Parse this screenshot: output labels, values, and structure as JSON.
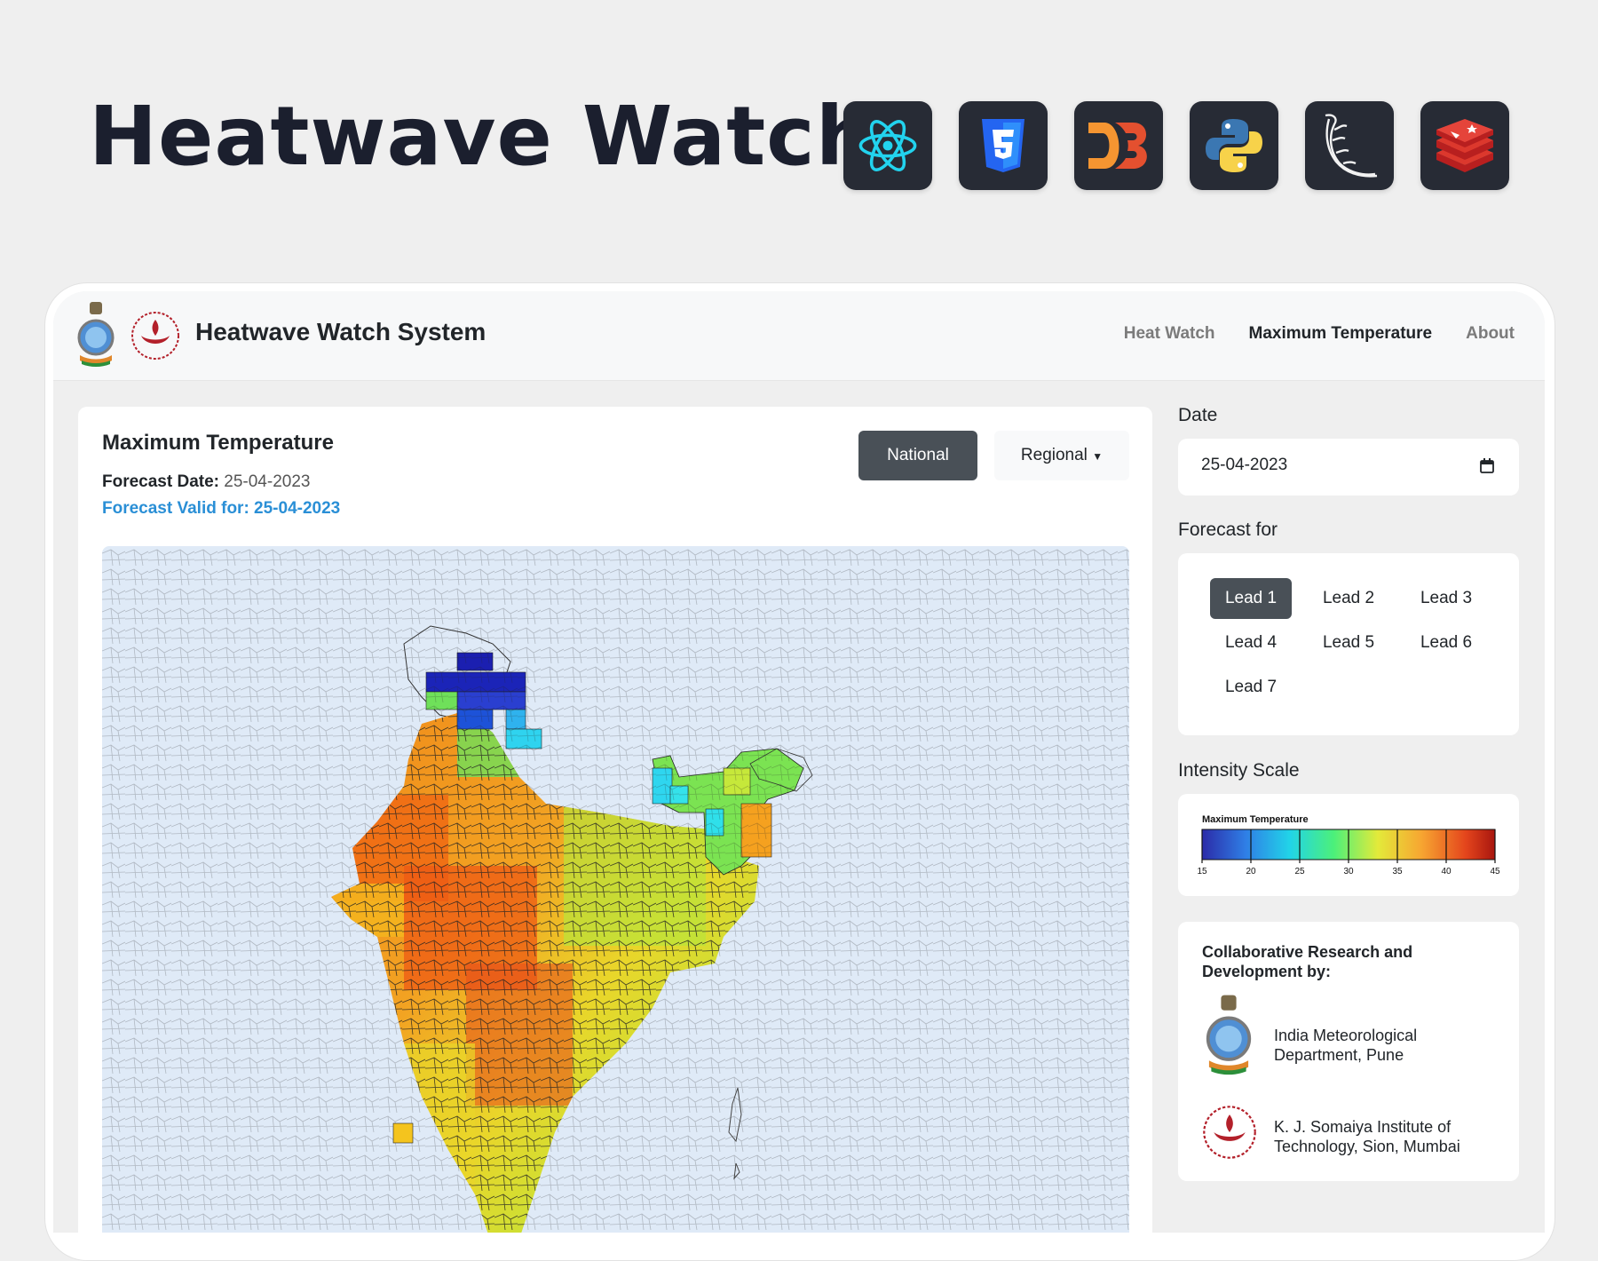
{
  "hero": {
    "title": "Heatwave Watch",
    "tech_icons": [
      "react-icon",
      "css3-icon",
      "d3-icon",
      "python-icon",
      "flask-icon",
      "redis-icon"
    ]
  },
  "navbar": {
    "brand": "Heatwave Watch System",
    "links": [
      "Heat Watch",
      "Maximum Temperature",
      "About"
    ],
    "active_link": "Maximum Temperature"
  },
  "map_card": {
    "title": "Maximum Temperature",
    "forecast_date_label": "Forecast Date:",
    "forecast_date_value": "25-04-2023",
    "forecast_valid": "Forecast Valid for: 25-04-2023",
    "national_label": "National",
    "regional_label": "Regional"
  },
  "sidebar": {
    "date_label": "Date",
    "date_value": "25-04-2023",
    "forecast_label": "Forecast for",
    "leads": [
      "Lead 1",
      "Lead 2",
      "Lead 3",
      "Lead 4",
      "Lead 5",
      "Lead 6",
      "Lead 7"
    ],
    "active_lead": "Lead 1",
    "scale_label": "Intensity Scale",
    "scale": {
      "title": "Maximum Temperature",
      "ticks": [
        "15",
        "20",
        "25",
        "30",
        "35",
        "40",
        "45"
      ],
      "colors": [
        "#2b2ba8",
        "#2f7fe6",
        "#21d4e8",
        "#4cf07a",
        "#e3ea3a",
        "#f7a531",
        "#e4451c",
        "#a8160f"
      ]
    },
    "collab_title": "Collaborative Research and Development by:",
    "orgs": [
      "India Meteorological Department, Pune",
      "K. J. Somaiya Institute of Technology, Sion, Mumbai"
    ]
  },
  "colors": {
    "accent_blue": "#2a8fd6",
    "button_dark": "#495057",
    "brand_dark": "#1b1f2e"
  }
}
